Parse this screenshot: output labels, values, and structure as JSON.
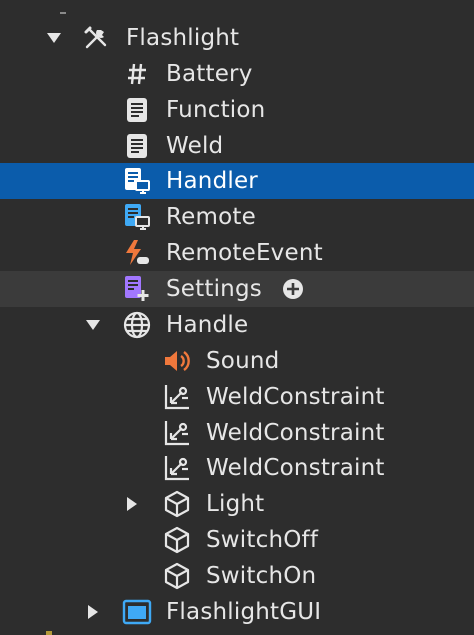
{
  "explorer": {
    "items": [
      {
        "label": "Flashlight",
        "icon": "tools-icon",
        "expanded": true
      },
      {
        "label": "Battery",
        "icon": "hash-icon"
      },
      {
        "label": "Function",
        "icon": "script-icon"
      },
      {
        "label": "Weld",
        "icon": "script-icon"
      },
      {
        "label": "Handler",
        "icon": "local-script-icon",
        "selected": true
      },
      {
        "label": "Remote",
        "icon": "local-script-icon"
      },
      {
        "label": "RemoteEvent",
        "icon": "remote-event-icon"
      },
      {
        "label": "Settings",
        "icon": "module-script-icon"
      },
      {
        "label": "Handle",
        "icon": "globe-icon",
        "expanded": true
      },
      {
        "label": "Sound",
        "icon": "speaker-icon"
      },
      {
        "label": "WeldConstraint",
        "icon": "weld-constraint-icon"
      },
      {
        "label": "WeldConstraint",
        "icon": "weld-constraint-icon"
      },
      {
        "label": "WeldConstraint",
        "icon": "weld-constraint-icon"
      },
      {
        "label": "Light",
        "icon": "cube-icon",
        "expanded": false
      },
      {
        "label": "SwitchOff",
        "icon": "cube-icon"
      },
      {
        "label": "SwitchOn",
        "icon": "cube-icon"
      },
      {
        "label": "FlashlightGUI",
        "icon": "screen-gui-icon",
        "expanded": false
      }
    ]
  },
  "colors": {
    "background": "#2d2d2d",
    "selected": "#0b5cab",
    "hover": "#3b3b3b",
    "text": "#e6e6e6",
    "script_blue": "#3fa9f5",
    "module_purple": "#a277ff",
    "event_orange": "#f0783c"
  }
}
